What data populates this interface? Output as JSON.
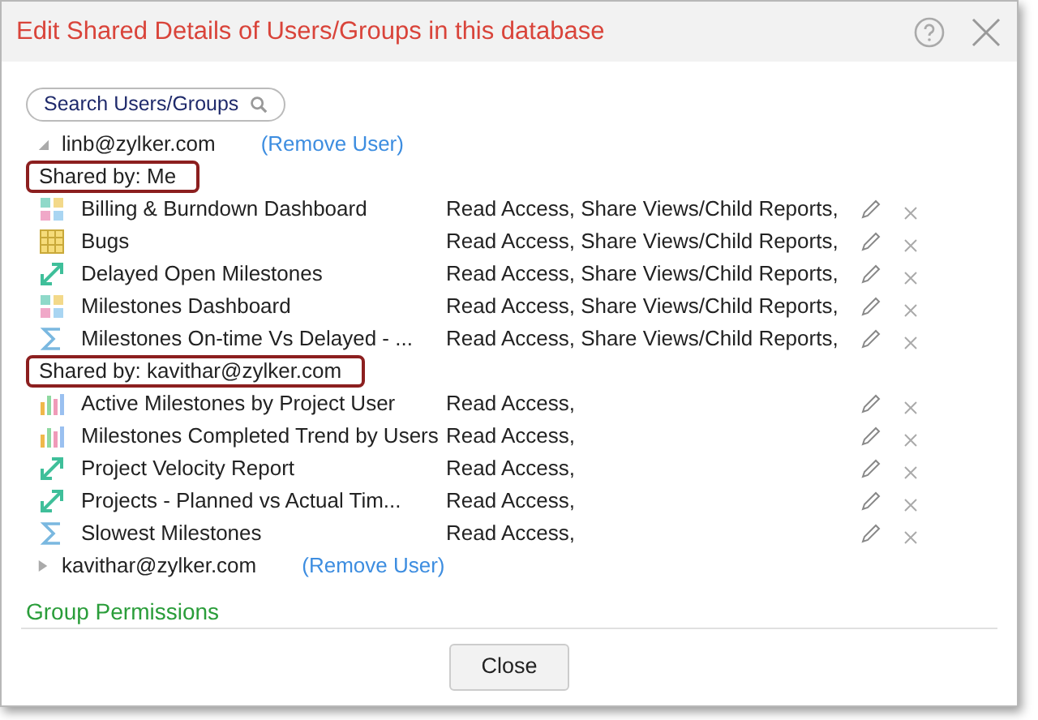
{
  "window": {
    "title": "Edit Shared Details of Users/Groups in this database"
  },
  "search": {
    "placeholder": "Search Users/Groups"
  },
  "users": [
    {
      "email": "linb@zylker.com",
      "action": "(Remove User)",
      "expanded": true,
      "groups": [
        {
          "shared_by": "Shared by: Me",
          "items": [
            {
              "kind": "dashboard",
              "name": "Billing & Burndown Dashboard",
              "access": "Read Access, Share Views/Child Reports,"
            },
            {
              "kind": "table",
              "name": "Bugs",
              "access": "Read Access, Share Views/Child Reports,"
            },
            {
              "kind": "trend",
              "name": "Delayed Open Milestones",
              "access": "Read Access, Share Views/Child Reports,"
            },
            {
              "kind": "dashboard",
              "name": "Milestones Dashboard",
              "access": "Read Access, Share Views/Child Reports,"
            },
            {
              "kind": "summary",
              "name": "Milestones On-time Vs Delayed - ...",
              "access": "Read Access, Share Views/Child Reports,"
            }
          ]
        },
        {
          "shared_by": "Shared by: kavithar@zylker.com",
          "items": [
            {
              "kind": "bars",
              "name": "Active Milestones by Project User",
              "access": "Read Access,"
            },
            {
              "kind": "bars",
              "name": "Milestones Completed Trend by Users",
              "access": "Read Access,"
            },
            {
              "kind": "trend",
              "name": "Project Velocity Report",
              "access": "Read Access,"
            },
            {
              "kind": "trend",
              "name": "Projects - Planned vs Actual Tim...",
              "access": "Read Access,"
            },
            {
              "kind": "summary",
              "name": "Slowest Milestones",
              "access": "Read Access,"
            }
          ]
        }
      ]
    },
    {
      "email": "kavithar@zylker.com",
      "action": "(Remove User)",
      "expanded": false
    }
  ],
  "section": "Group Permissions",
  "buttons": [
    "Close"
  ]
}
